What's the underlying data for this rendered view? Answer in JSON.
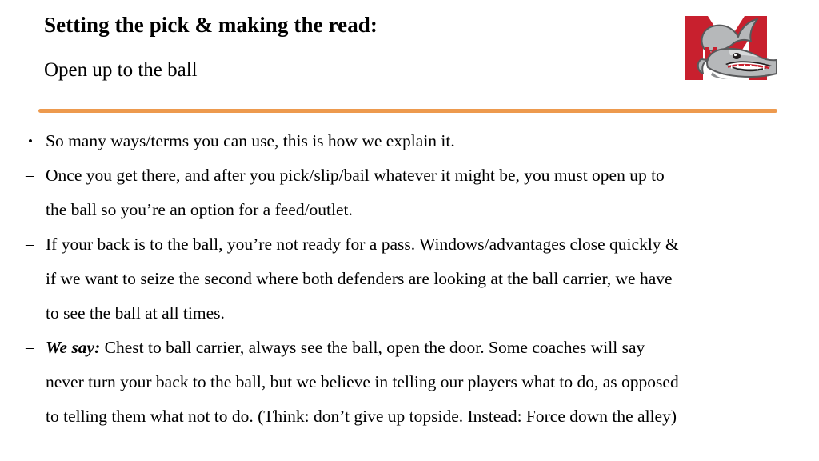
{
  "slide": {
    "title": "Setting the pick & making the read:",
    "subtitle": "Open up to the ball",
    "divider_color": "#ED9A4E",
    "background_color": "#FFFFFF",
    "text_color": "#000000"
  },
  "logo": {
    "name": "mascot-logo",
    "description": "Red letter M with gray shark mascot wearing braces",
    "letter": "M",
    "primary_color": "#C8202E",
    "shark_color": "#B6B8BA",
    "shark_shadow": "#8B8D8F",
    "braces_color": "#C8202E",
    "teeth_color": "#FFFFFF",
    "outline_color": "#58595B"
  },
  "content": {
    "items": [
      {
        "marker": "•",
        "marker_type": "dot",
        "lines": [
          {
            "text": "So many ways/terms you can use, this is how we explain it."
          }
        ]
      },
      {
        "marker": "–",
        "marker_type": "dash",
        "lines": [
          {
            "text": "Once you get there, and after you pick/slip/bail whatever it might be, you must open up to"
          },
          {
            "text": "the ball so you’re an option for a feed/outlet."
          }
        ]
      },
      {
        "marker": "–",
        "marker_type": "dash",
        "lines": [
          {
            "text": "If your back is to the ball, you’re not ready for a pass. Windows/advantages close quickly &"
          },
          {
            "text": "if we want to seize the second where both defenders are looking at the ball carrier, we have"
          },
          {
            "text": "to see the ball at all times."
          }
        ]
      },
      {
        "marker": "–",
        "marker_type": "dash",
        "lines": [
          {
            "emphasis": "We say:",
            "text": " Chest to ball carrier, always see the ball, open the door. Some coaches will say"
          },
          {
            "text": "never turn your back to the ball, but we believe in telling our players what to do, as opposed"
          },
          {
            "text": "to telling them what not to do. (Think: don’t give up topside. Instead: Force down the alley)"
          }
        ]
      }
    ]
  }
}
